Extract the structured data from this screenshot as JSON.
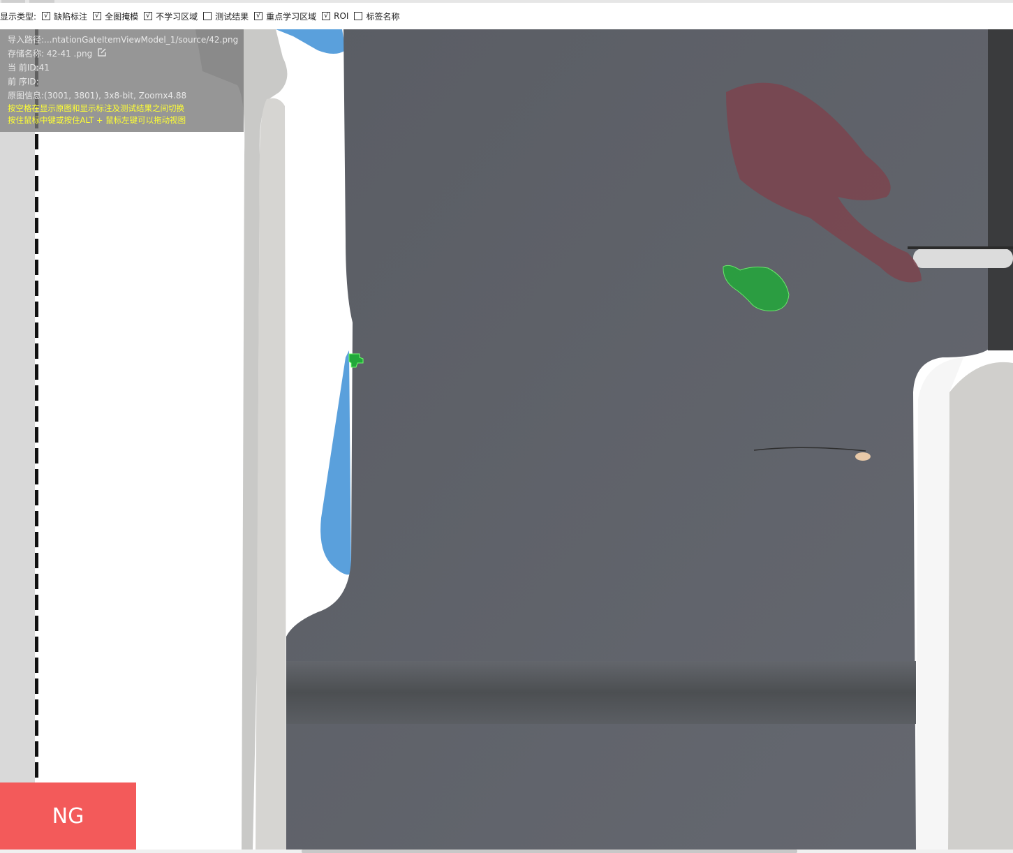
{
  "toolbar": {
    "display_type_label": "显示类型:",
    "options": [
      {
        "label": "缺陷标注",
        "checked": true,
        "mark": "√"
      },
      {
        "label": "全图掩模",
        "checked": true,
        "mark": "√"
      },
      {
        "label": "不学习区域",
        "checked": true,
        "mark": "√"
      },
      {
        "label": "测试结果",
        "checked": false,
        "mark": ""
      },
      {
        "label": "重点学习区域",
        "checked": true,
        "mark": "√"
      },
      {
        "label": "ROI",
        "checked": true,
        "mark": "√"
      },
      {
        "label": "标签名称",
        "checked": false,
        "mark": ""
      }
    ]
  },
  "info": {
    "import_path": "导入路径:...ntationGateItemViewModel_1/source/42.png",
    "save_name": "存储名称: 42-41 .png",
    "current_id": "当 前ID:41",
    "prev_id": "前 序ID:",
    "image_info": "原图信息:(3001, 3801), 3x8-bit, Zoomx4.88",
    "hint1": "按空格在显示原图和显示标注及测试结果之间切换",
    "hint2": "按住鼠标中键或按住ALT + 鼠标左键可以拖动视图",
    "edit_icon": "edit-icon"
  },
  "status": {
    "result": "NG",
    "color": "#f35a5a"
  },
  "colors": {
    "background_part": "#5e6168",
    "defect_mask": "#22a83a",
    "ink_mark": "#7a4650",
    "blue_film": "#5aa0dc"
  }
}
